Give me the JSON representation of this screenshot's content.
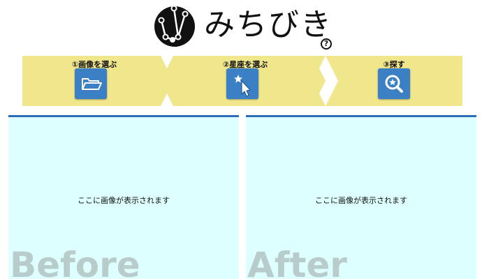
{
  "header": {
    "title": "みちびき",
    "help_icon": "?"
  },
  "steps": [
    {
      "label": "①画像を選ぶ",
      "icon": "folder-open-icon"
    },
    {
      "label": "②星座を選ぶ",
      "icon": "star-cursor-icon"
    },
    {
      "label": "③探す",
      "icon": "star-search-icon"
    }
  ],
  "panels": {
    "before": {
      "message": "ここに画像が表示されます",
      "watermark": "Before"
    },
    "after": {
      "message": "ここに画像が表示されます",
      "watermark": "After"
    }
  },
  "colors": {
    "step_bg": "#f0e68c",
    "button_bg": "#3b7fc4",
    "panel_bg": "#deffff",
    "panel_border": "#2c6db5",
    "watermark": "#b8cccc"
  }
}
